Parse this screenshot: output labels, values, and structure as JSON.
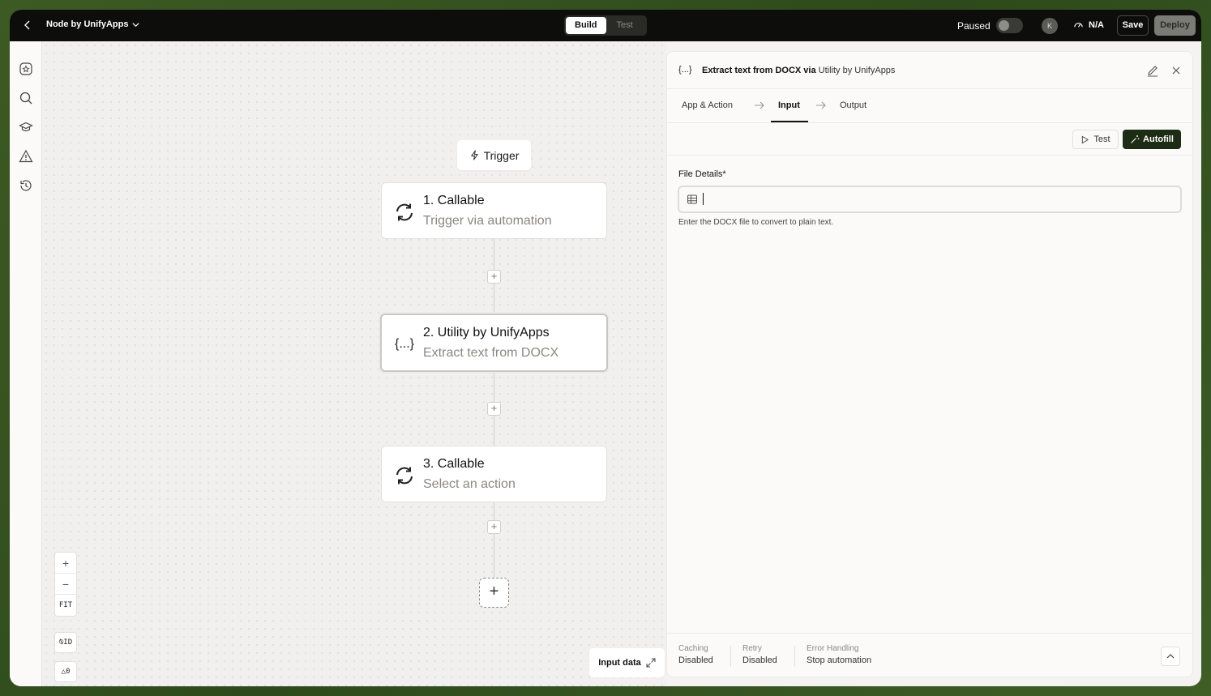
{
  "topbar": {
    "app_title": "Node by UnifyApps",
    "mode_tabs": [
      "Build",
      "Test"
    ],
    "status_label": "Paused",
    "avatar_initial": "K",
    "metric": "N/A",
    "save_label": "Save",
    "deploy_label": "Deploy"
  },
  "canvas": {
    "trigger_label": "Trigger",
    "nodes": [
      {
        "title": "1. Callable",
        "subtitle": "Trigger via automation",
        "icon": "refresh-icon"
      },
      {
        "title": "2. Utility by UnifyApps",
        "subtitle": "Extract text from DOCX",
        "icon": "braces-icon"
      },
      {
        "title": "3. Callable",
        "subtitle": "Select an action",
        "icon": "refresh-icon"
      }
    ],
    "zoom": {
      "fit_label": "FIT",
      "id_label": "ID",
      "warnings_count": "0"
    },
    "input_data_label": "Input data"
  },
  "panel": {
    "icon_text": "{...}",
    "title_main": "Extract text from DOCX via",
    "title_by": "Utility by UnifyApps",
    "steps": [
      "App & Action",
      "Input",
      "Output"
    ],
    "active_step": "Input",
    "test_label": "Test",
    "autofill_label": "Autofill",
    "field": {
      "label": "File Details*",
      "value": "",
      "help": "Enter the DOCX file to convert to plain text."
    },
    "footer": [
      {
        "label": "Caching",
        "value": "Disabled"
      },
      {
        "label": "Retry",
        "value": "Disabled"
      },
      {
        "label": "Error Handling",
        "value": "Stop automation"
      }
    ]
  }
}
